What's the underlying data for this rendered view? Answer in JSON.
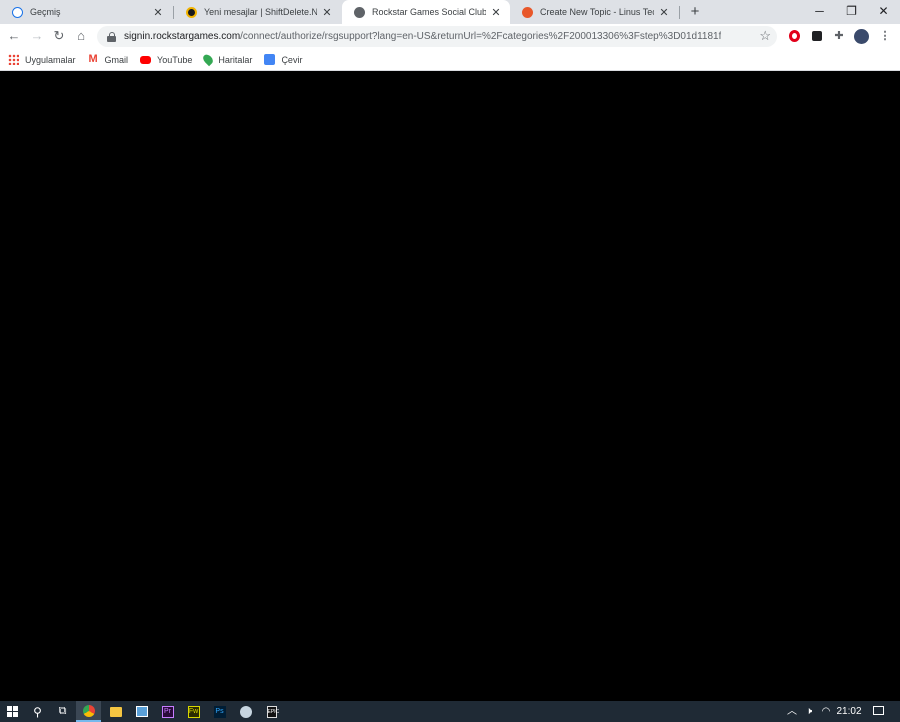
{
  "tabs": [
    {
      "title": "Geçmiş",
      "icon": "history-icon",
      "active": false
    },
    {
      "title": "Yeni mesajlar | ShiftDelete.Net Fo",
      "icon": "shiftdelete-icon",
      "active": false
    },
    {
      "title": "Rockstar Games Social Club",
      "icon": "globe-icon",
      "active": true
    },
    {
      "title": "Create New Topic - Linus Tech Tip",
      "icon": "linus-tech-tips-icon",
      "active": false
    }
  ],
  "url": {
    "host": "signin.rockstargames.com",
    "path": "/connect/authorize/rsgsupport?lang=en-US&returnUrl=%2Fcategories%2F200013306%3Fstep%3D01d1181f"
  },
  "bookmarks": [
    {
      "label": "Uygulamalar",
      "icon": "apps-grid-icon"
    },
    {
      "label": "Gmail",
      "icon": "gmail-icon"
    },
    {
      "label": "YouTube",
      "icon": "youtube-icon"
    },
    {
      "label": "Haritalar",
      "icon": "maps-icon"
    },
    {
      "label": "Çevir",
      "icon": "translate-icon"
    }
  ],
  "taskbar": {
    "apps": [
      "start-icon",
      "search-icon",
      "task-view-icon",
      "chrome-icon",
      "file-explorer-icon",
      "app-icon",
      "premiere-icon",
      "fireworks-icon",
      "photoshop-icon",
      "steam-icon",
      "epic-games-icon"
    ],
    "tray_clock": "21:02"
  },
  "colors": {
    "tabstrip": "#dee1e6",
    "content": "#000000",
    "taskbar": "#1f2a35"
  }
}
